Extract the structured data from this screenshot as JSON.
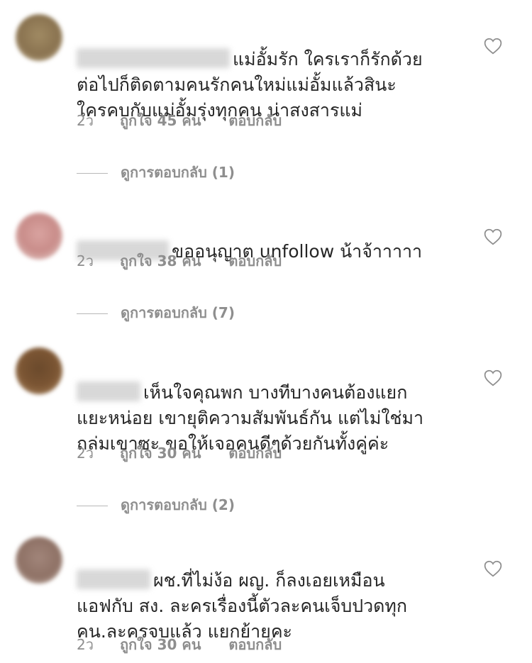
{
  "comments": [
    {
      "text_rest": "แม่อั้มรัก ใครเราก็รักด้วย\nต่อไปก็ติดตามคนรักคนใหม่แม่อั้มแล้วสินะ\nใครคบกับแม่อั้มรุ่งทุกคน น่าสงสารแม่",
      "time": "2ว",
      "likes": "ถูกใจ 45 คน",
      "reply": "ตอบกลับ",
      "view_replies": "ดูการตอบกลับ (1)"
    },
    {
      "text_rest": "ขออนุญาต unfollow น้าจ้าาาาา",
      "time": "2ว",
      "likes": "ถูกใจ 38 คน",
      "reply": "ตอบกลับ",
      "view_replies": "ดูการตอบกลับ (7)"
    },
    {
      "text_rest": "เห็นใจคุณพก บางทีบางคนต้องแยก\nแยะหน่อย เขายุติความสัมพันธ์กัน แต่ไม่ใช่มา\nถล่มเขาซะ ขอให้เจอคนดีๆด้วยกันทั้งคู่ค่ะ",
      "time": "2ว",
      "likes": "ถูกใจ 30 คน",
      "reply": "ตอบกลับ",
      "view_replies": "ดูการตอบกลับ (2)"
    },
    {
      "text_rest": "ผช.ที่ไม่ง้อ ผญ.  ก็ลงเอยเหมือน\nแอฟกับ สง. ละครเรื่องนี้ตัวละคนเจ็บปวดทุก\nคน.ละครจบแล้ว แยกย้ายคะ",
      "time": "2ว",
      "likes": "ถูกใจ 30 คน",
      "reply": "ตอบกลับ"
    }
  ],
  "colors": {
    "text": "#262626",
    "meta": "#8e8e8e",
    "divider": "#b8b8b8"
  },
  "icons": {
    "like": "heart-outline-icon"
  }
}
